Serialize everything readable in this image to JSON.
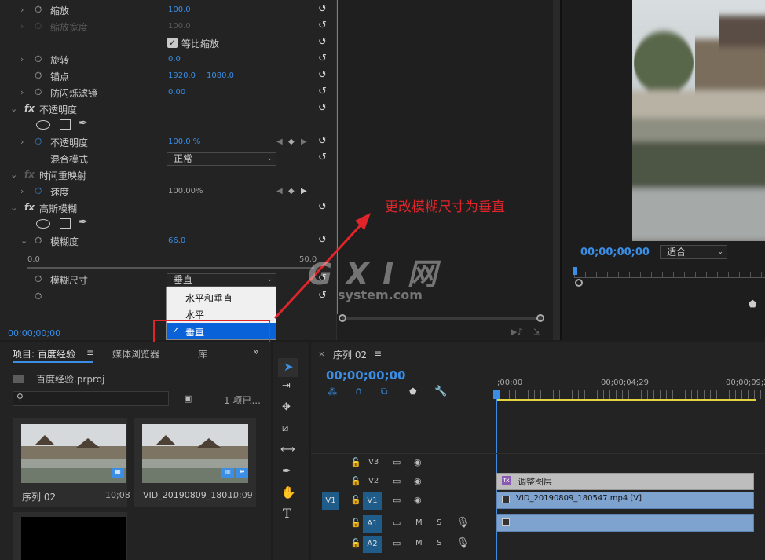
{
  "effect_controls": {
    "rows": [
      {
        "label": "缩放",
        "v1": "100.0",
        "v2": ""
      },
      {
        "label": "缩放宽度",
        "v1": "100.0",
        "v2": ""
      },
      {
        "label": "旋转",
        "v1": "0.0",
        "v2": ""
      },
      {
        "label": "锚点",
        "v1": "1920.0",
        "v2": "1080.0"
      },
      {
        "label": "防闪烁滤镜",
        "v1": "0.00",
        "v2": ""
      }
    ],
    "uniform_scale_label": "等比缩放",
    "opacity_section": "不透明度",
    "opacity_label": "不透明度",
    "opacity_value": "100.0 %",
    "blend_label": "混合模式",
    "blend_value": "正常",
    "remap_section": "时间重映射",
    "speed_label": "速度",
    "speed_value": "100.00%",
    "gauss_section": "高斯模糊",
    "blur_label": "模糊度",
    "blur_value": "66.0",
    "slider_min": "0.0",
    "slider_max": "50.0",
    "blur_dim_label": "模糊尺寸",
    "blur_dim_value": "垂直",
    "dropdown_options": [
      "水平和垂直",
      "水平",
      "垂直"
    ],
    "checkmark": "✓",
    "timecode": "00;00;00;00"
  },
  "annotation": "更改模糊尺寸为垂直",
  "watermark": {
    "logo": "G X I 网",
    "domain": "system.com"
  },
  "monitor": {
    "timecode": "00;00;00;00",
    "fit": "适合"
  },
  "project": {
    "tabs": [
      "项目: 百度经验",
      "媒体浏览器",
      "库"
    ],
    "file": "百度经验.prproj",
    "count": "1 项已...",
    "items": [
      {
        "name": "序列 02",
        "dur": "10;08"
      },
      {
        "name": "VID_20190809_180...",
        "dur": "10;09"
      }
    ]
  },
  "timeline": {
    "tab": "序列 02",
    "timecode": "00;00;00;00",
    "ruler": [
      ";00;00",
      "00;00;04;29",
      "00;00;09;2"
    ],
    "tracks": [
      "V3",
      "V2",
      "V1",
      "A1",
      "A2"
    ],
    "source_v1": "V1",
    "clip_adjust": "调整图层",
    "clip_video": "VID_20190809_180547.mp4 [V]",
    "fx_badge": "fx",
    "mute": "M",
    "solo": "S"
  },
  "colors": {
    "accent": "#3a8ee6",
    "annotation": "#e0252a",
    "timeline_clip": "#7fa3cf",
    "adjustment_clip": "#bdbdbd"
  }
}
